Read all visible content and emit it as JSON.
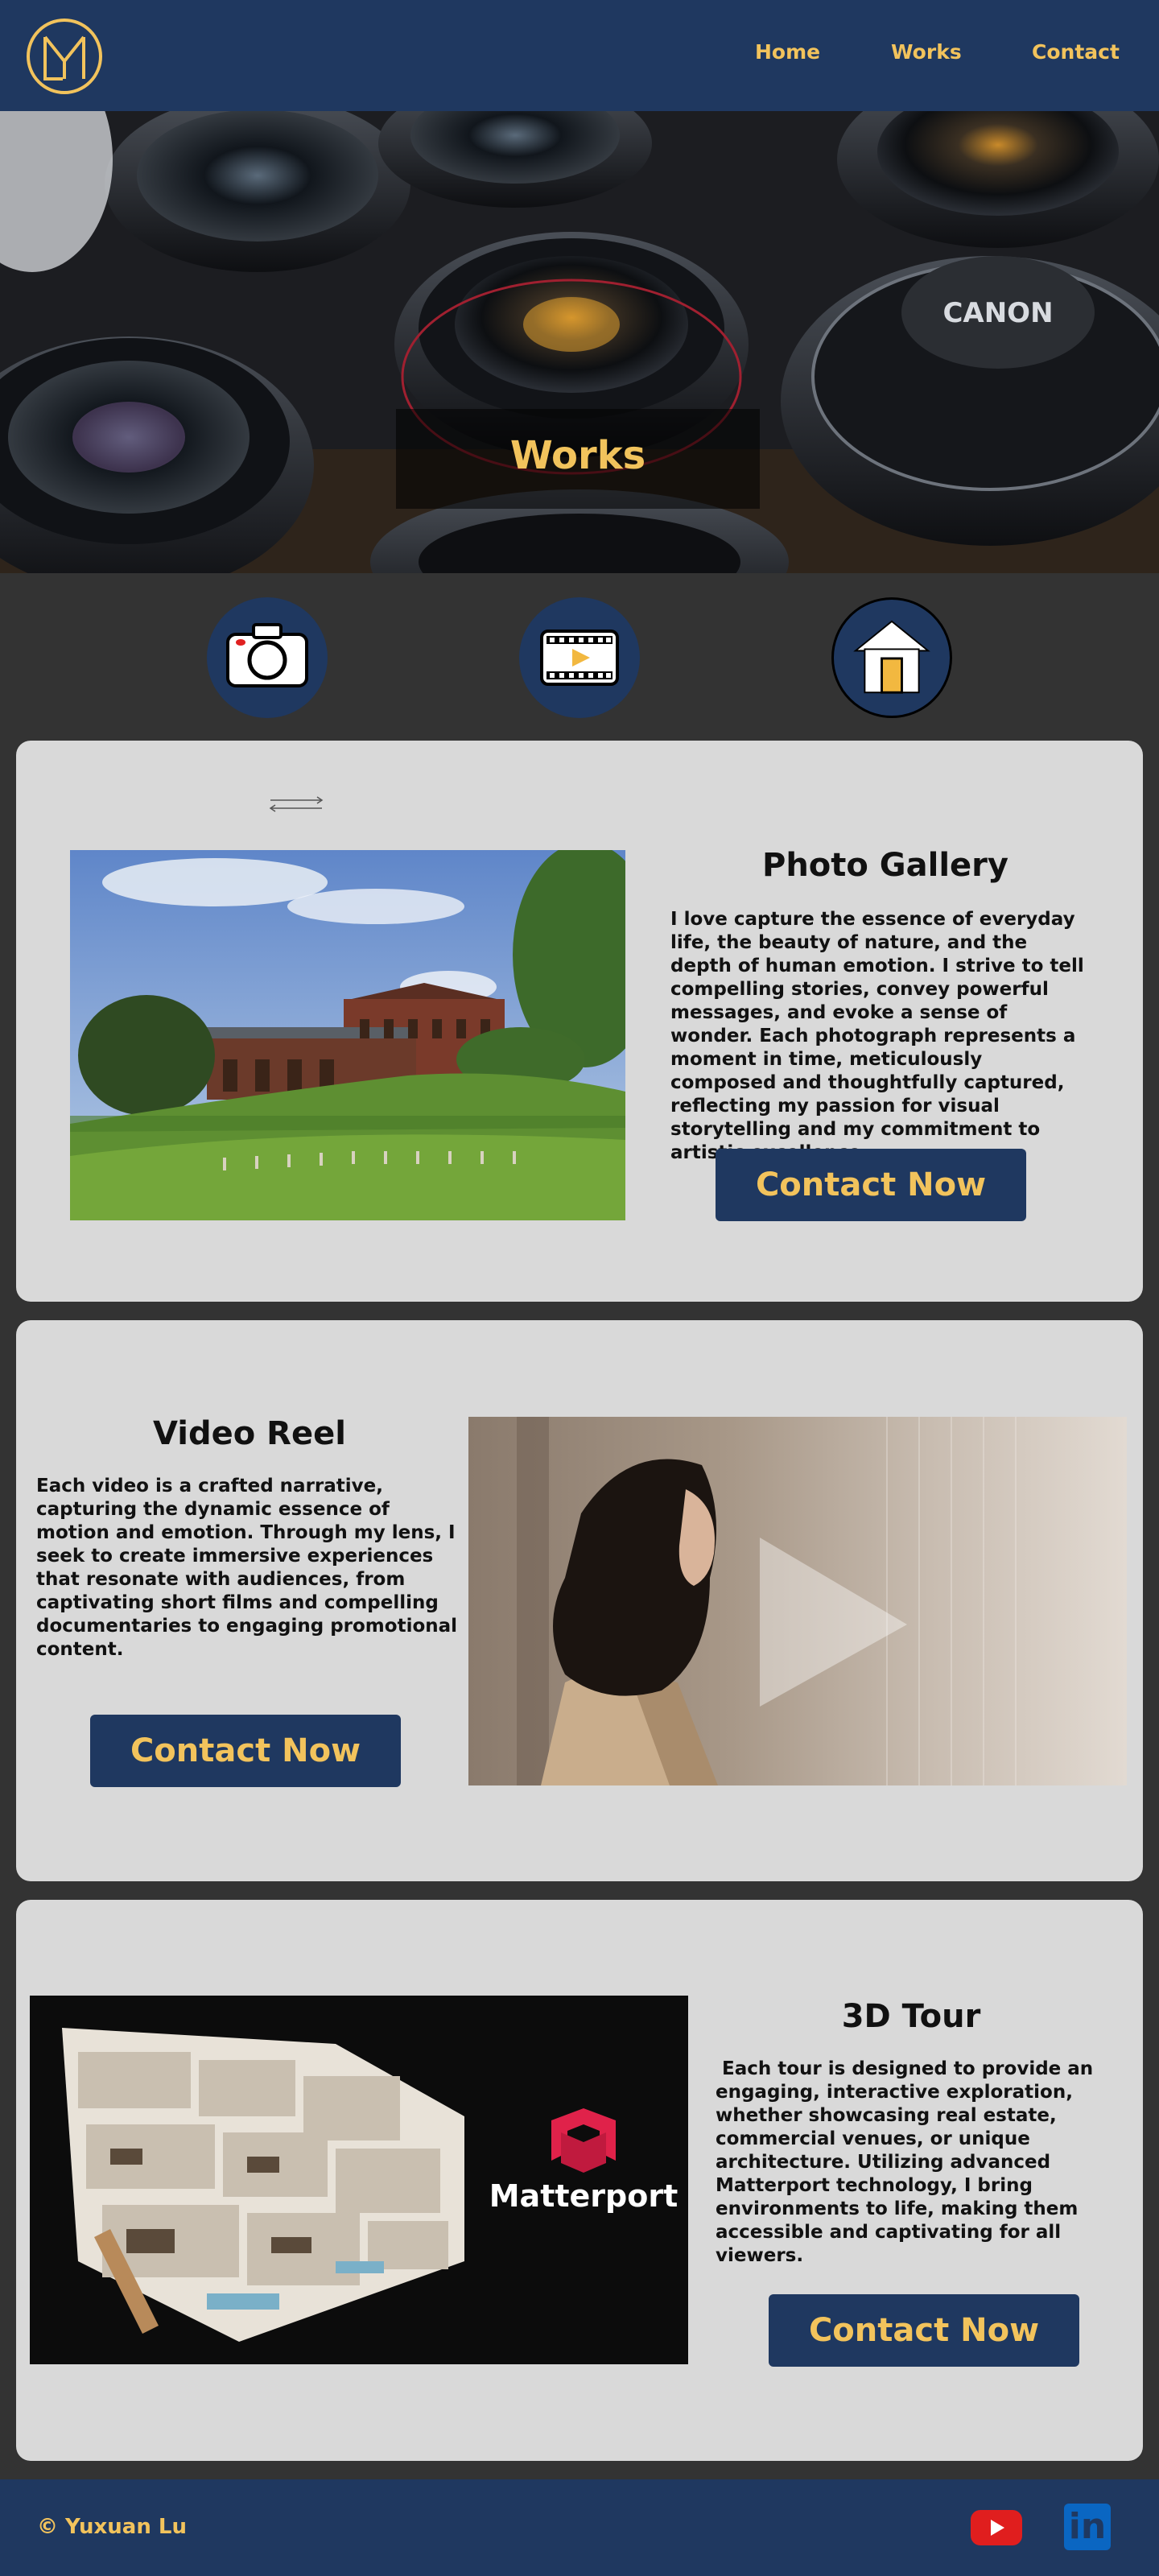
{
  "header": {
    "logo_letters": "YL",
    "nav": [
      {
        "label": "Home"
      },
      {
        "label": "Works"
      },
      {
        "label": "Contact"
      }
    ]
  },
  "hero": {
    "title": "Works",
    "lens_brand_text": "CANON"
  },
  "category_icons": [
    {
      "name": "camera-icon"
    },
    {
      "name": "film-video-icon"
    },
    {
      "name": "house-icon"
    }
  ],
  "sections": [
    {
      "heading": "Photo Gallery",
      "body": "I love capture the essence of everyday life, the beauty of nature, and the depth of human emotion. I strive to tell compelling stories, convey powerful messages, and evoke a sense of wonder. Each photograph represents a moment in time, meticulously composed and thoughtfully captured, reflecting my passion for visual storytelling and my commitment to artistic excellence.",
      "button_label": "Contact Now"
    },
    {
      "heading": "Video Reel",
      "body": "Each video is a crafted narrative, capturing the dynamic essence of motion and emotion. Through my lens, I seek to create immersive experiences that resonate with audiences, from captivating short films and compelling documentaries to engaging promotional content.",
      "button_label": "Contact Now"
    },
    {
      "heading": "3D Tour",
      "body": " Each tour is designed to provide an engaging, interactive exploration, whether showcasing real estate, commercial venues, or unique architecture. Utilizing advanced Matterport technology, I bring environments to life, making them accessible and captivating for all viewers.",
      "button_label": "Contact Now",
      "brand_logo_text": "Matterport"
    }
  ],
  "footer": {
    "copyright": "© Yuxuan Lu",
    "social": [
      {
        "name": "youtube-icon"
      },
      {
        "name": "linkedin-icon",
        "text": "in"
      }
    ]
  },
  "colors": {
    "navy": "#1f3860",
    "gold": "#f2c35c",
    "background": "#333333",
    "card": "#d9d9d9"
  }
}
